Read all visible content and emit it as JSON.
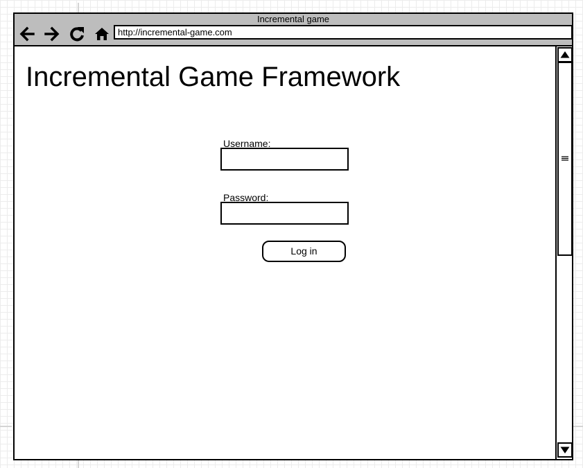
{
  "window": {
    "title": "Incremental game"
  },
  "toolbar": {
    "back_icon": "arrow-left-icon",
    "forward_icon": "arrow-right-icon",
    "reload_icon": "refresh-icon",
    "home_icon": "home-icon",
    "url": "http://incremental-game.com"
  },
  "page": {
    "heading": "Incremental Game Framework",
    "username_label": "Username:",
    "username_value": "",
    "password_label": "Password:",
    "password_value": "",
    "login_label": "Log in"
  },
  "scrollbar": {
    "up_icon": "triangle-up-icon",
    "down_icon": "triangle-down-icon",
    "thumb_icon": "grip-lines-icon"
  },
  "colors": {
    "chrome": "#bdbdbd",
    "border": "#000000",
    "background": "#ffffff",
    "canvas_grid": "#ececec"
  }
}
